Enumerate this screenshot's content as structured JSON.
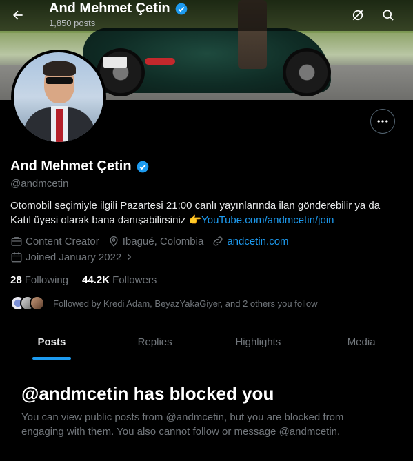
{
  "header": {
    "name": "And Mehmet Çetin",
    "posts_count": "1,850 posts"
  },
  "profile": {
    "name": "And Mehmet Çetin",
    "handle": "@andmcetin",
    "bio_text": "Otomobil seçimiyle ilgili Pazartesi 21:00 canlı yayınlarında ilan gönderebilir ya da Katıl üyesi olarak bana danışabilirsiniz 👉",
    "bio_link": "YouTube.com/andmcetin/join",
    "category": "Content Creator",
    "location": "Ibagué, Colombia",
    "website": "andcetin.com",
    "joined": "Joined January 2022",
    "following_count": "28",
    "following_label": "Following",
    "followers_count": "44.2K",
    "followers_label": "Followers",
    "followed_by": "Followed by Kredi Adam, BeyazYakaGiyer, and 2 others you follow"
  },
  "tabs": [
    {
      "label": "Posts",
      "active": true
    },
    {
      "label": "Replies",
      "active": false
    },
    {
      "label": "Highlights",
      "active": false
    },
    {
      "label": "Media",
      "active": false
    }
  ],
  "blocked": {
    "title": "@andmcetin has blocked you",
    "description": "You can view public posts from @andmcetin, but you are blocked from engaging with them. You also cannot follow or message @andmcetin."
  },
  "colors": {
    "accent": "#1d9bf0",
    "background": "#000000",
    "secondary_text": "#71767b"
  }
}
